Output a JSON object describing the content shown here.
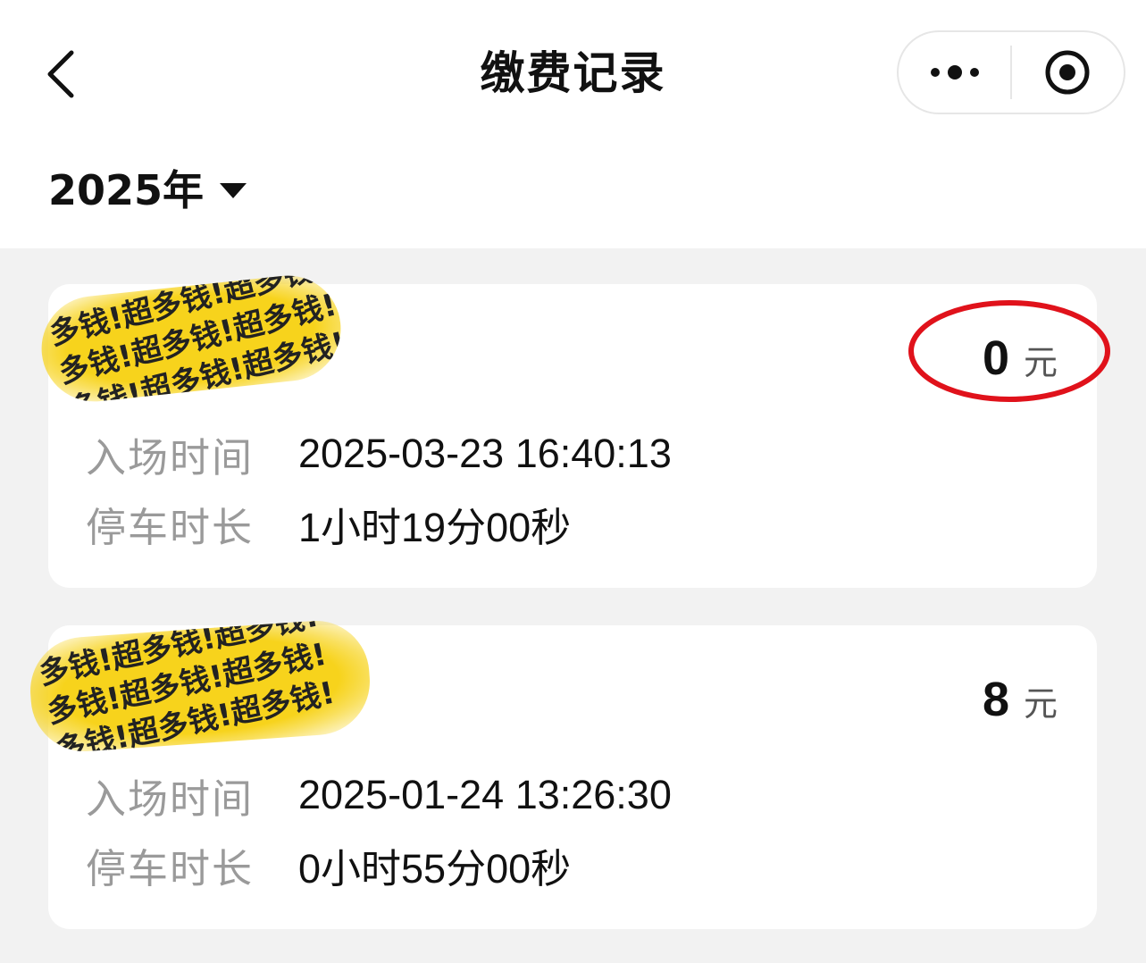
{
  "header": {
    "title": "缴费记录",
    "back_icon": "chevron-left-icon",
    "more_icon": "more-dots-icon",
    "close_icon": "target-circle-icon"
  },
  "filter": {
    "year_label": "2025年",
    "caret_icon": "caret-down-icon"
  },
  "records": [
    {
      "plate_overlay_text": "多钱!超多钱!超\n多钱!超多钱!超",
      "amount": "0",
      "unit": "元",
      "annotated": true,
      "entry_label": "入场时间",
      "entry_time": "2025-03-23 16:40:13",
      "duration_label": "停车时长",
      "duration": "1小时19分00秒"
    },
    {
      "plate_overlay_text": "多钱!超多钱!超\n多钱!超多钱!超",
      "amount": "8",
      "unit": "元",
      "annotated": false,
      "entry_label": "入场时间",
      "entry_time": "2025-01-24 13:26:30",
      "duration_label": "停车时长",
      "duration": "0小时55分00秒"
    }
  ],
  "colors": {
    "background": "#f2f2f2",
    "card": "#ffffff",
    "highlight": "#f7d31c",
    "annotation": "#e0121b",
    "label": "#9a9a9a"
  }
}
